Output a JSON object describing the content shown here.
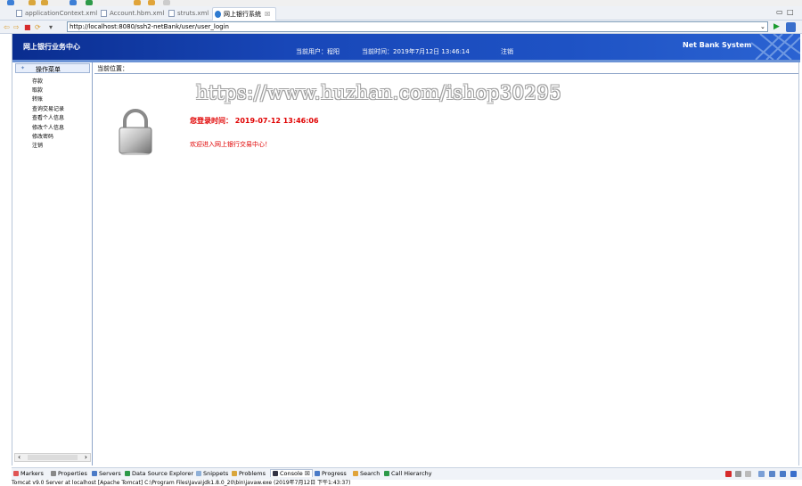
{
  "ide": {
    "editor_tabs": [
      {
        "label": "applicationContext.xml",
        "active": false
      },
      {
        "label": "Account.hbm.xml",
        "active": false
      },
      {
        "label": "struts.xml",
        "active": false
      },
      {
        "label": "网上银行系统",
        "active": true,
        "close": "☒"
      }
    ],
    "window_controls": {
      "minimize": "▭",
      "maximize": "□"
    }
  },
  "browser": {
    "url": "http://localhost:8080/ssh2-netBank/user/user_login",
    "dropdown": "⌄",
    "go": "▶"
  },
  "banner": {
    "title": "网上银行业务中心",
    "user_text": "当前用户：程阳",
    "time_text": "当前时间：2019年7月12日 13:46:14",
    "logout": "注销",
    "system_name": "Net Bank System"
  },
  "sidebar": {
    "header": "操作菜单",
    "items": [
      "存款",
      "取款",
      "转账",
      "查询交易记录",
      "查看个人信息",
      "修改个人信息",
      "修改密码",
      "注销"
    ]
  },
  "main": {
    "breadcrumb": "当前位置：",
    "watermark": "https://www.huzhan.com/ishop30295",
    "login_time": "您登录时间：  2019-07-12 13:46:06",
    "welcome": "欢迎进入网上银行交易中心！"
  },
  "bottom_views": {
    "tabs": [
      "Markers",
      "Properties",
      "Servers",
      "Data Source Explorer",
      "Snippets",
      "Problems",
      "Console",
      "Progress",
      "Search",
      "Call Hierarchy"
    ],
    "active_tab": "Console",
    "console_text": "Tomcat v9.0 Server at localhost [Apache Tomcat] C:\\Program Files\\Java\\jdk1.8.0_20\\bin\\javaw.exe (2019年7月12日 下午1:43:37)"
  },
  "colors": {
    "banner": "#1847b8",
    "alert_red": "#e00000"
  }
}
